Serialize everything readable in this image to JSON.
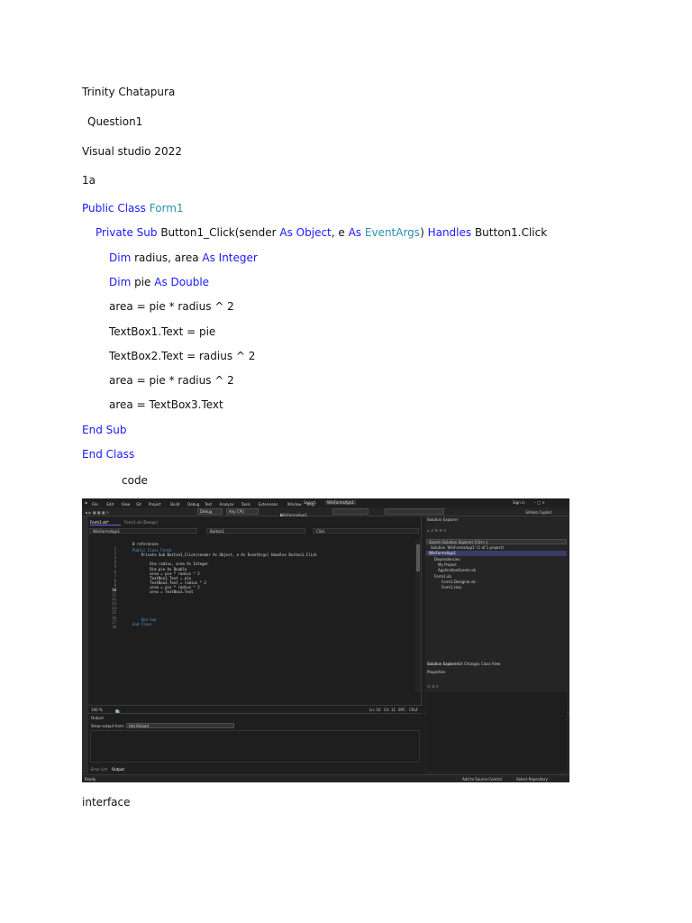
{
  "document": {
    "author": "Trinity Chatapura",
    "question": "Question1",
    "software": "Visual studio 2022",
    "part": "1a",
    "code_lines": [
      {
        "indent": 0,
        "parts": [
          {
            "t": "Public Class ",
            "c": "kw"
          },
          {
            "t": "Form1",
            "c": "ty"
          }
        ]
      },
      {
        "indent": 1,
        "parts": [
          {
            "t": "Private Sub ",
            "c": "kw"
          },
          {
            "t": "Button1_Click(sender ",
            "c": ""
          },
          {
            "t": "As Object",
            "c": "kw"
          },
          {
            "t": ", e ",
            "c": ""
          },
          {
            "t": "As ",
            "c": "kw"
          },
          {
            "t": "EventArgs",
            "c": "ty"
          },
          {
            "t": ") ",
            "c": ""
          },
          {
            "t": "Handles ",
            "c": "kw"
          },
          {
            "t": "Button1.Click",
            "c": ""
          }
        ]
      },
      {
        "indent": 2,
        "parts": [
          {
            "t": "Dim ",
            "c": "kw"
          },
          {
            "t": "radius, area ",
            "c": ""
          },
          {
            "t": "As Integer",
            "c": "kw"
          }
        ]
      },
      {
        "indent": 2,
        "parts": [
          {
            "t": "Dim ",
            "c": "kw"
          },
          {
            "t": "pie ",
            "c": ""
          },
          {
            "t": "As Double",
            "c": "kw"
          }
        ]
      },
      {
        "indent": 2,
        "parts": [
          {
            "t": "area = pie * radius ^ 2",
            "c": ""
          }
        ]
      },
      {
        "indent": 2,
        "parts": [
          {
            "t": "TextBox1.Text = pie",
            "c": ""
          }
        ]
      },
      {
        "indent": 2,
        "parts": [
          {
            "t": "TextBox2.Text = radius ^ 2",
            "c": ""
          }
        ]
      },
      {
        "indent": 2,
        "parts": [
          {
            "t": "area = pie * radius ^ 2",
            "c": ""
          }
        ]
      },
      {
        "indent": 2,
        "parts": [
          {
            "t": "area = TextBox3.Text",
            "c": ""
          }
        ]
      },
      {
        "indent": 0,
        "parts": [
          {
            "t": "End Sub",
            "c": "kw"
          }
        ]
      },
      {
        "indent": 0,
        "parts": [
          {
            "t": "End Class",
            "c": "kw"
          }
        ]
      }
    ],
    "code_caption": "code",
    "interface_caption": "interface"
  },
  "ide": {
    "menu": [
      "File",
      "Edit",
      "View",
      "Git",
      "Project",
      "Build",
      "Debug",
      "Test",
      "Analyze",
      "Tools",
      "Extensions",
      "Window",
      "Help"
    ],
    "search": "Search",
    "solution_name": "WinFormsApp1",
    "sign_in": "Sign in",
    "toolbar": {
      "config": "Debug",
      "platform": "Any CPU",
      "run": "WinFormsApp1",
      "copilot": "GitHub Copilot"
    },
    "tabs": {
      "active": "Form1.vb*",
      "inactive": "Form1.vb [Design]"
    },
    "nav": {
      "project": "WinFormsApp1",
      "object": "Button1",
      "event": "Click"
    },
    "line_numbers": [
      "1",
      "2",
      "3",
      "4",
      "5",
      "6",
      "7",
      "8",
      "9",
      "10",
      "11",
      "12",
      "13",
      "14",
      "15",
      "16",
      "17",
      "18"
    ],
    "references": "0 references",
    "code": [
      "Public Class Form1",
      "    Private Sub Button1_Click(sender As Object, e As EventArgs) Handles Button1.Click",
      "        Dim radius, area As Integer",
      "        Dim pie As Double",
      "        area = pie * radius ^ 2",
      "        TextBox1.Text = pie",
      "        TextBox2.Text = radius ^ 2",
      "        area = pie * radius ^ 2",
      "        area = TextBox3.Text",
      "    End Sub",
      "End Class"
    ],
    "editor_status": {
      "zoom": "100 %",
      "issues": "No issues found",
      "ln": "Ln: 10",
      "ch": "Ch: 11",
      "spc": "SPC",
      "crlf": "CRLF"
    },
    "output": {
      "title": "Output",
      "label": "Show output from:",
      "source": "Hot Reload"
    },
    "bottom_tabs": [
      "Error List",
      "Output"
    ],
    "status": {
      "ready": "Ready",
      "source_control": "Add to Source Control",
      "repository": "Select Repository"
    },
    "solution_explorer": {
      "title": "Solution Explorer",
      "search": "Search Solution Explorer (Ctrl+;)",
      "items": [
        "Solution 'WinFormsApp1' (1 of 1 project)",
        "WinFormsApp1",
        "Dependencies",
        "My Project",
        "ApplicationEvents.vb",
        "Form1.vb",
        "Form1.Designer.vb",
        "Form1.resx"
      ],
      "tabs": [
        "Solution Explorer",
        "Git Changes",
        "Class View"
      ]
    },
    "properties": {
      "title": "Properties"
    }
  }
}
